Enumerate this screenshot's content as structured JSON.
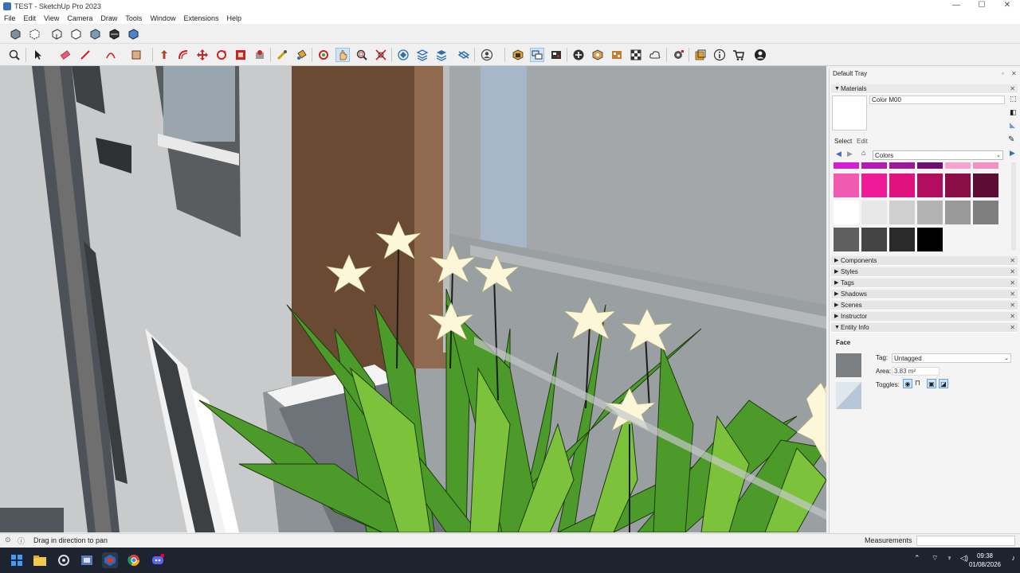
{
  "window": {
    "title": "TEST - SketchUp Pro 2023",
    "controls": {
      "minimize": "—",
      "maximize": "☐",
      "close": "✕"
    }
  },
  "menu": [
    "File",
    "Edit",
    "View",
    "Camera",
    "Draw",
    "Tools",
    "Window",
    "Extensions",
    "Help"
  ],
  "toolbar_icons": {
    "row1": [
      "xray-icon",
      "back-edges-icon",
      "wireframe-icon",
      "hidden-line-icon",
      "shaded-icon",
      "shaded-textures-icon",
      "monochrome-icon"
    ],
    "row2": [
      "zoom-icon",
      "select-icon",
      "eraser-icon",
      "line-icon",
      "arc-icon",
      "rectangle-icon",
      "push-pull-icon",
      "offset-icon",
      "move-icon",
      "rotate-icon",
      "scale-icon",
      "follow-me-icon",
      "tape-measure-icon",
      "paint-bucket-icon",
      "orbit-icon",
      "pan-icon",
      "zoom-window-icon",
      "zoom-extents-icon",
      "iso-view-icon",
      "top-view-icon",
      "front-view-icon",
      "section-plane-icon",
      "user-icon",
      "components-icon",
      "outliner-icon",
      "model-info-icon",
      "add-location-icon",
      "photo-texture-icon",
      "material-icon",
      "checkerboard-icon",
      "cloud-icon",
      "extension-manager-icon",
      "layout-icon",
      "info-icon",
      "cart-icon",
      "account-icon"
    ]
  },
  "tray": {
    "title": "Default Tray",
    "materials": {
      "header": "Materials",
      "material_name": "Color M00",
      "tabs": {
        "select": "Select",
        "edit": "Edit"
      },
      "library": "Colors",
      "swatches": [
        [
          "#d21fd2",
          "#b21cb0",
          "#9a1a98",
          "#6e106f",
          "#f6a3cf",
          "#f290c4"
        ],
        [
          "#f05ab1",
          "#ef1a97",
          "#e0127e",
          "#b30d5f",
          "#8a0e46",
          "#5f0c34"
        ],
        [
          "#ffffff",
          "#e8e8e8",
          "#cfcfcf",
          "#b3b3b3",
          "#999999",
          "#7f7f7f"
        ],
        [
          "#5f5f5f",
          "#444444",
          "#2a2a2a",
          "#000000"
        ]
      ]
    },
    "sections": [
      "Components",
      "Styles",
      "Tags",
      "Shadows",
      "Scenes",
      "Instructor",
      "Entity Info"
    ],
    "entity_info": {
      "type": "Face",
      "tag_label": "Tag:",
      "tag_value": "Untagged",
      "area_label": "Area:",
      "area_value": "3.83 m²",
      "toggles_label": "Toggles:"
    }
  },
  "status": {
    "hint": "Drag in direction to pan",
    "measurements_label": "Measurements"
  },
  "taskbar": {
    "time": "09:38",
    "date": "01/08/2026",
    "apps": [
      "windows-start-icon",
      "file-explorer-icon",
      "settings-icon",
      "app-icon",
      "sketchup-icon",
      "chrome-icon",
      "discord-icon"
    ]
  }
}
